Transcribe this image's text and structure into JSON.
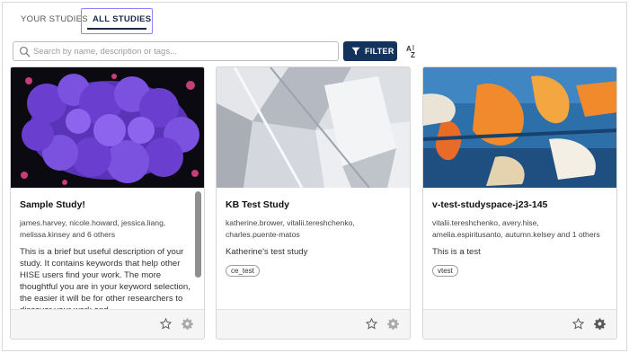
{
  "tabs": {
    "your_studies": "YOUR STUDIES",
    "all_studies": "ALL STUDIES"
  },
  "search": {
    "placeholder": "Search by name, description or tags..."
  },
  "filter_button": {
    "label": "FILTER"
  },
  "sort": {
    "icon": "sort-alpha-icon"
  },
  "colors": {
    "accent": "#14335c",
    "tab_highlight": "#8a86ef"
  },
  "studies": [
    {
      "title": "Sample Study!",
      "authors": "james.harvey, nicole.howard, jessica.liang, melissa.kinsey and 6 others",
      "description": "This is a brief but useful description of your study. It contains keywords that help other HISE users find your work. The more thoughtful you are in your keyword selection, the easier it will be for other researchers to discover your work and",
      "tag": "",
      "image": "purple-virus-micrograph"
    },
    {
      "title": "KB Test Study",
      "authors": "katherine.brower, vitalii.tereshchenko, charles.puente-matos",
      "description": "Katherine's test study",
      "tag": "ce_test",
      "image": "gray-geometric-architecture"
    },
    {
      "title": "v-test-studyspace-j23-145",
      "authors": "vitalii.tereshchenko, avery.hise, amelia.espiritusanto, autumn.kelsey and 1 others",
      "description": "This is a test",
      "tag": "vtest",
      "image": "abstract-blue-orange-painting"
    }
  ]
}
